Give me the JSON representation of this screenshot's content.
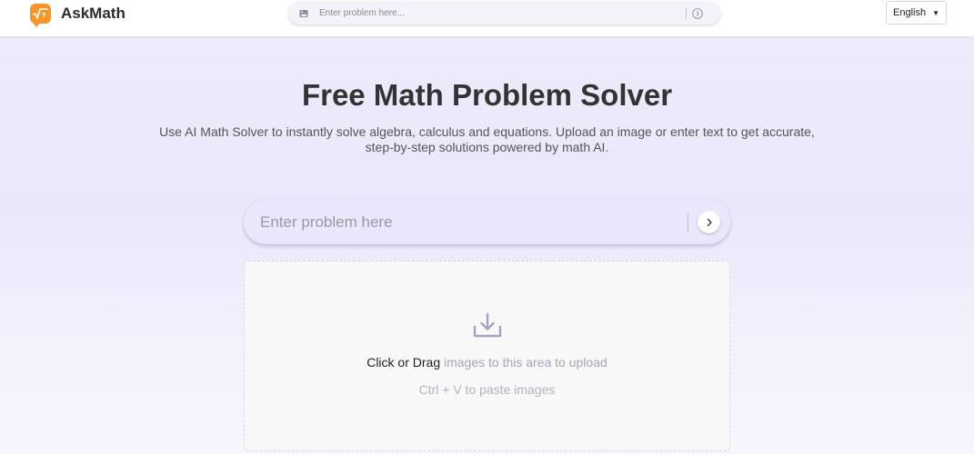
{
  "header": {
    "brand": "AskMath",
    "logo_icon": "square-root-question-icon",
    "search_placeholder": "Enter problem here...",
    "language": "English"
  },
  "hero": {
    "title": "Free Math Problem Solver",
    "subtitle": "Use AI Math Solver to instantly solve algebra, calculus and equations. Upload an image or enter text to get accurate, step-by-step solutions powered by math AI."
  },
  "main_search": {
    "placeholder": "Enter problem here"
  },
  "upload": {
    "click_drag": "Click or Drag",
    "rest": " images to this area to upload",
    "paste_hint": "Ctrl + V to paste images"
  },
  "colors": {
    "brand_orange": "#f5962a",
    "hero_bg": "#e9e7fa"
  }
}
